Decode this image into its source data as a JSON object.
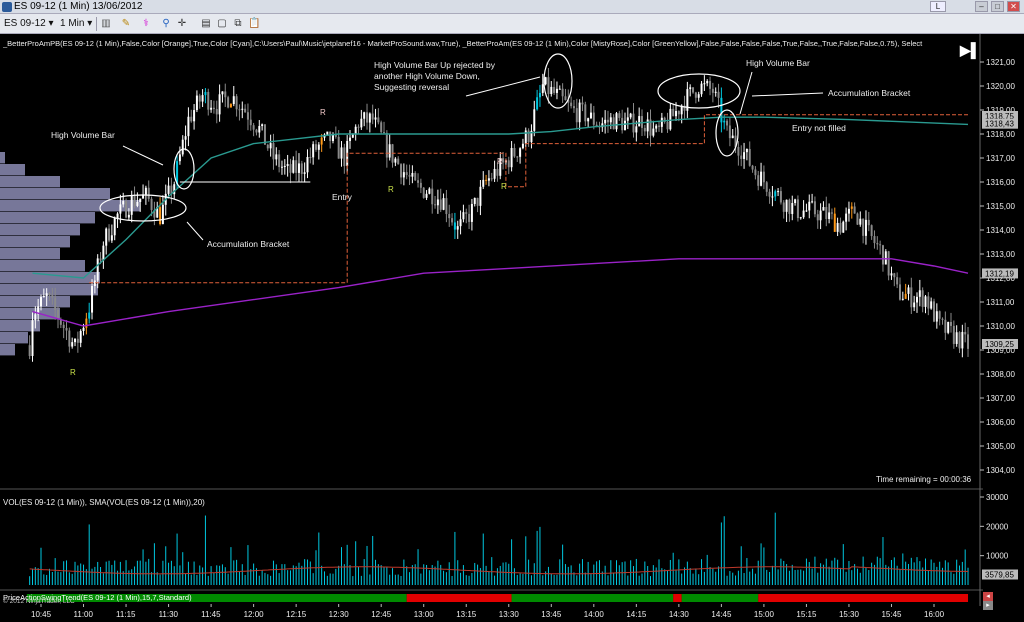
{
  "window": {
    "title": "ES 09-12 (1 Min)  13/06/2012",
    "link_btn": "L",
    "min_btn": "–",
    "max_btn": "□",
    "close_btn": "✕"
  },
  "toolbar": {
    "instrument": "ES 09-12",
    "interval": "1 Min"
  },
  "indicator_label": "_BetterProAmPB(ES 09-12 (1 Min),False,Color [Orange],True,Color [Cyan],C:\\Users\\Paul\\Music\\jetplanef16 - MarketProSound.wav,True), _BetterProAm(ES 09-12 (1 Min),Color [MistyRose],Color [GreenYellow],False,False,False,False,True,False,,True,False,False,0.75), Select",
  "annotations": {
    "high_volume_bar_left": "High Volume Bar",
    "accumulation_left": "Accumulation Bracket",
    "entry_left": "Entry",
    "rejected_line1": "High Volume Bar Up rejected by",
    "rejected_line2": "another High Volume Down,",
    "rejected_line3": "Suggesting reversal",
    "high_volume_bar_right": "High Volume Bar",
    "accumulation_right": "Accumulation Bracket",
    "entry_not_filled": "Entry not filled",
    "r_markers": [
      "R",
      "R",
      "R",
      "R",
      "R"
    ]
  },
  "time_remaining": "Time remaining = 00:00:36",
  "volume_label": "VOL(ES 09-12 (1 Min)), SMA(VOL(ES 09-12 (1 Min)),20)",
  "trend_label": "PriceActionSwingTrend(ES 09-12 (1 Min),15,7,Standard)",
  "copyright": "© 2012 NinjaTrader, LLC",
  "colors": {
    "background": "#000000",
    "up_bar": "#ffffff",
    "high_volume_bar": "#00c8e0",
    "pro_bar": "#ff9a1a",
    "ema_teal": "#2a9a90",
    "sma_purple": "#9a22c8",
    "profile": "#8c8cb4",
    "bracket_orange": "#e0603a",
    "trend_green": "#008a00",
    "trend_red": "#e00000"
  },
  "chart_data": {
    "type": "candlestick",
    "price_axis": {
      "min": 1303.5,
      "max": 1321.5,
      "ticks": [
        "1321,00",
        "1320,00",
        "1319,00",
        "1318,00",
        "1317,00",
        "1316,00",
        "1315,00",
        "1314,00",
        "1313,00",
        "1312,00",
        "1311,00",
        "1310,00",
        "1309,00",
        "1308,00",
        "1307,00",
        "1306,00",
        "1305,00",
        "1304,00"
      ],
      "markers": [
        {
          "label": "1318,75",
          "value": 1318.75
        },
        {
          "label": "1318,43",
          "value": 1318.43
        },
        {
          "label": "1312,19",
          "value": 1312.19
        },
        {
          "label": "1309,25",
          "value": 1309.25
        }
      ]
    },
    "time_axis": [
      "10:45",
      "11:00",
      "11:15",
      "11:30",
      "11:45",
      "12:00",
      "12:15",
      "12:30",
      "12:45",
      "13:00",
      "13:15",
      "13:30",
      "13:45",
      "14:00",
      "14:15",
      "14:30",
      "14:45",
      "15:00",
      "15:15",
      "15:30",
      "15:45",
      "16:00"
    ],
    "volume_axis": {
      "ticks": [
        "30000",
        "20000",
        "10000"
      ],
      "current_label": "3579,85",
      "current_value": 3579.85
    },
    "close_path": [
      {
        "t": "10:42",
        "p": 1310.5
      },
      {
        "t": "10:47",
        "p": 1311.2
      },
      {
        "t": "10:52",
        "p": 1310.2
      },
      {
        "t": "10:57",
        "p": 1309.1
      },
      {
        "t": "11:02",
        "p": 1310.8
      },
      {
        "t": "11:07",
        "p": 1313.5
      },
      {
        "t": "11:12",
        "p": 1314.6
      },
      {
        "t": "11:17",
        "p": 1315.2
      },
      {
        "t": "11:22",
        "p": 1315.4
      },
      {
        "t": "11:27",
        "p": 1314.6
      },
      {
        "t": "11:32",
        "p": 1316.0
      },
      {
        "t": "11:37",
        "p": 1318.6
      },
      {
        "t": "11:42",
        "p": 1319.6
      },
      {
        "t": "11:47",
        "p": 1319.2
      },
      {
        "t": "11:52",
        "p": 1319.6
      },
      {
        "t": "11:57",
        "p": 1319.0
      },
      {
        "t": "12:02",
        "p": 1318.2
      },
      {
        "t": "12:07",
        "p": 1317.0
      },
      {
        "t": "12:12",
        "p": 1316.4
      },
      {
        "t": "12:17",
        "p": 1316.6
      },
      {
        "t": "12:22",
        "p": 1317.4
      },
      {
        "t": "12:27",
        "p": 1317.8
      },
      {
        "t": "12:32",
        "p": 1317.0
      },
      {
        "t": "12:37",
        "p": 1318.5
      },
      {
        "t": "12:42",
        "p": 1318.6
      },
      {
        "t": "12:47",
        "p": 1317.4
      },
      {
        "t": "12:52",
        "p": 1316.6
      },
      {
        "t": "12:57",
        "p": 1315.8
      },
      {
        "t": "13:02",
        "p": 1315.6
      },
      {
        "t": "13:07",
        "p": 1315.2
      },
      {
        "t": "13:12",
        "p": 1314.0
      },
      {
        "t": "13:17",
        "p": 1314.8
      },
      {
        "t": "13:22",
        "p": 1316.0
      },
      {
        "t": "13:27",
        "p": 1316.6
      },
      {
        "t": "13:32",
        "p": 1317.2
      },
      {
        "t": "13:37",
        "p": 1318.0
      },
      {
        "t": "13:42",
        "p": 1320.0
      },
      {
        "t": "13:47",
        "p": 1319.6
      },
      {
        "t": "13:52",
        "p": 1319.0
      },
      {
        "t": "13:57",
        "p": 1318.8
      },
      {
        "t": "14:02",
        "p": 1318.4
      },
      {
        "t": "14:07",
        "p": 1318.6
      },
      {
        "t": "14:12",
        "p": 1318.4
      },
      {
        "t": "14:17",
        "p": 1318.6
      },
      {
        "t": "14:22",
        "p": 1318.0
      },
      {
        "t": "14:27",
        "p": 1318.6
      },
      {
        "t": "14:32",
        "p": 1319.4
      },
      {
        "t": "14:37",
        "p": 1320.0
      },
      {
        "t": "14:42",
        "p": 1319.8
      },
      {
        "t": "14:47",
        "p": 1318.0
      },
      {
        "t": "14:52",
        "p": 1317.4
      },
      {
        "t": "14:57",
        "p": 1316.4
      },
      {
        "t": "15:02",
        "p": 1315.8
      },
      {
        "t": "15:07",
        "p": 1315.2
      },
      {
        "t": "15:12",
        "p": 1314.8
      },
      {
        "t": "15:17",
        "p": 1314.8
      },
      {
        "t": "15:22",
        "p": 1314.6
      },
      {
        "t": "15:27",
        "p": 1314.2
      },
      {
        "t": "15:32",
        "p": 1314.8
      },
      {
        "t": "15:37",
        "p": 1313.8
      },
      {
        "t": "15:42",
        "p": 1313.0
      },
      {
        "t": "15:47",
        "p": 1311.4
      },
      {
        "t": "15:52",
        "p": 1311.2
      },
      {
        "t": "15:57",
        "p": 1311.2
      },
      {
        "t": "16:02",
        "p": 1310.0
      },
      {
        "t": "16:07",
        "p": 1309.6
      },
      {
        "t": "16:12",
        "p": 1309.2
      }
    ],
    "sma_path": [
      {
        "t": "10:42",
        "p": 1310.6
      },
      {
        "t": "11:00",
        "p": 1310.0
      },
      {
        "t": "11:30",
        "p": 1310.6
      },
      {
        "t": "12:00",
        "p": 1311.1
      },
      {
        "t": "12:30",
        "p": 1311.6
      },
      {
        "t": "13:00",
        "p": 1312.2
      },
      {
        "t": "13:30",
        "p": 1312.4
      },
      {
        "t": "14:00",
        "p": 1312.6
      },
      {
        "t": "14:30",
        "p": 1312.8
      },
      {
        "t": "15:00",
        "p": 1312.8
      },
      {
        "t": "15:30",
        "p": 1312.8
      },
      {
        "t": "15:45",
        "p": 1312.8
      },
      {
        "t": "16:00",
        "p": 1312.5
      },
      {
        "t": "16:12",
        "p": 1312.2
      }
    ],
    "ema_path": [
      {
        "t": "10:42",
        "p": 1312.2
      },
      {
        "t": "11:00",
        "p": 1312.0
      },
      {
        "t": "11:15",
        "p": 1313.6
      },
      {
        "t": "11:30",
        "p": 1315.4
      },
      {
        "t": "11:45",
        "p": 1317.0
      },
      {
        "t": "12:00",
        "p": 1317.6
      },
      {
        "t": "12:15",
        "p": 1317.8
      },
      {
        "t": "12:30",
        "p": 1318.0
      },
      {
        "t": "12:45",
        "p": 1318.0
      },
      {
        "t": "13:00",
        "p": 1318.0
      },
      {
        "t": "13:30",
        "p": 1318.0
      },
      {
        "t": "13:45",
        "p": 1318.1
      },
      {
        "t": "14:00",
        "p": 1318.3
      },
      {
        "t": "14:30",
        "p": 1318.6
      },
      {
        "t": "14:45",
        "p": 1318.7
      },
      {
        "t": "15:00",
        "p": 1318.7
      },
      {
        "t": "15:30",
        "p": 1318.6
      },
      {
        "t": "16:12",
        "p": 1318.4
      }
    ],
    "bracket_path": [
      {
        "t": "11:02",
        "p": 1311.8
      },
      {
        "t": "12:33",
        "p": 1311.8
      },
      {
        "t": "12:33",
        "p": 1317.2
      },
      {
        "t": "13:29",
        "p": 1317.2
      },
      {
        "t": "13:29",
        "p": 1315.8
      },
      {
        "t": "13:36",
        "p": 1315.8
      },
      {
        "t": "13:36",
        "p": 1317.6
      },
      {
        "t": "14:39",
        "p": 1317.6
      },
      {
        "t": "14:39",
        "p": 1318.8
      },
      {
        "t": "16:12",
        "p": 1318.8
      }
    ],
    "entry_line": {
      "from": "11:34",
      "to": "12:20",
      "p": 1316.0
    },
    "trend_segments": [
      {
        "from": "10:40",
        "to": "12:54",
        "trend": "up"
      },
      {
        "from": "12:54",
        "to": "13:31",
        "trend": "down"
      },
      {
        "from": "13:31",
        "to": "14:28",
        "trend": "up"
      },
      {
        "from": "14:28",
        "to": "14:31",
        "trend": "down"
      },
      {
        "from": "14:31",
        "to": "14:58",
        "trend": "up"
      },
      {
        "from": "14:58",
        "to": "16:12",
        "trend": "down"
      }
    ]
  }
}
